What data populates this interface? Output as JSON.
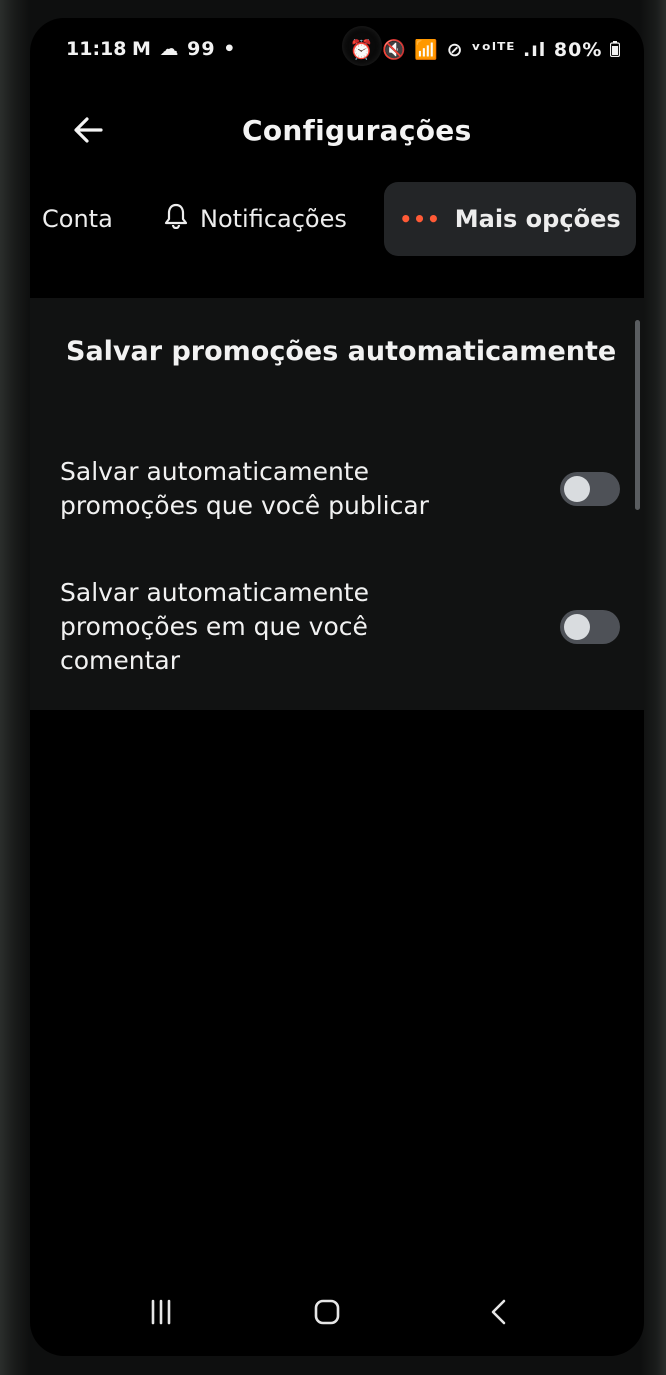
{
  "status_bar": {
    "time": "11:18",
    "left_icons": "M ☁ 99 •",
    "right_icons": "⏰ 🔇 📶 ⊘ ᵛᵒˡᵀᴱ .ıl",
    "battery": "80%"
  },
  "app_bar": {
    "title": "Configurações",
    "back_icon": "arrow-left-icon"
  },
  "tabs": [
    {
      "label": "Conta",
      "icon": null,
      "selected": false
    },
    {
      "label": "Notificações",
      "icon": "bell-icon",
      "selected": false
    },
    {
      "label": "Mais opções",
      "icon": "more-dots-icon",
      "selected": true
    }
  ],
  "section": {
    "title": "Salvar promoções automaticamente"
  },
  "settings": [
    {
      "label": "Salvar automaticamente promoções que você publicar",
      "enabled": false
    },
    {
      "label": "Salvar automaticamente promoções em que você comentar",
      "enabled": false
    }
  ],
  "nav_bar": {
    "recents_icon": "recents-icon",
    "home_icon": "home-icon",
    "back_icon": "chevron-left-icon"
  },
  "colors": {
    "background": "#000000",
    "panel": "#111212",
    "selected_tab": "#232527",
    "accent": "#ff5a36",
    "toggle_off_track": "#4e5157",
    "toggle_knob": "#d9dcdf"
  }
}
